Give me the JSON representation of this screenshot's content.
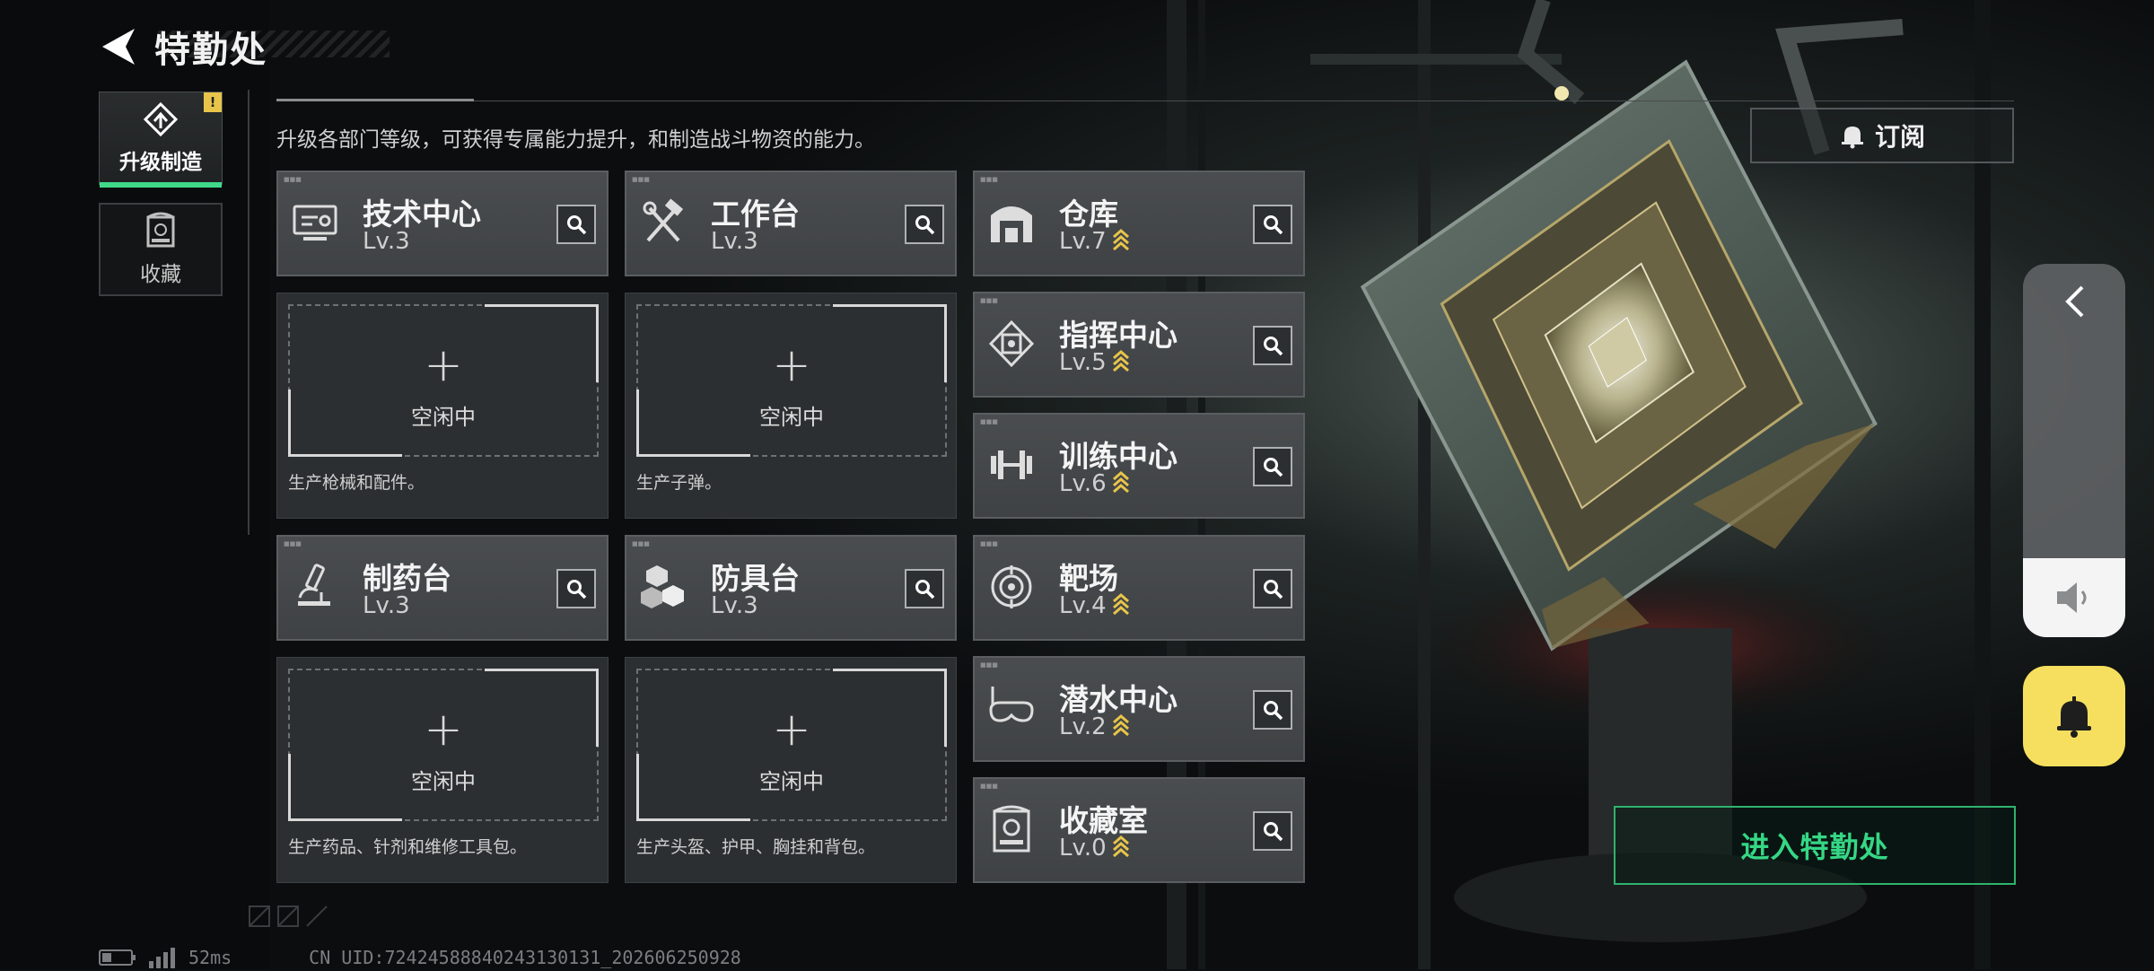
{
  "header": {
    "title": "特勤处"
  },
  "tabs": [
    {
      "label": "升级制造",
      "active": true,
      "badge": "!"
    },
    {
      "label": "收藏",
      "active": false
    }
  ],
  "description": "升级各部门等级，可获得专属能力提升，和制造战斗物资的能力。",
  "subscribe_button": {
    "label": "订阅"
  },
  "departments": {
    "tech_center": {
      "name": "技术中心",
      "level": "Lv.3",
      "icon": "monitor-icon"
    },
    "workbench": {
      "name": "工作台",
      "level": "Lv.3",
      "icon": "hammer-wrench-icon"
    },
    "pharmacy": {
      "name": "制药台",
      "level": "Lv.3",
      "icon": "microscope-icon"
    },
    "armor_bench": {
      "name": "防具台",
      "level": "Lv.3",
      "icon": "cubes-icon"
    },
    "warehouse": {
      "name": "仓库",
      "level": "Lv.7",
      "icon": "warehouse-icon",
      "upgradable": true
    },
    "command_center": {
      "name": "指挥中心",
      "level": "Lv.5",
      "icon": "chip-icon",
      "upgradable": true
    },
    "training_center": {
      "name": "训练中心",
      "level": "Lv.6",
      "icon": "dumbbell-icon",
      "upgradable": true
    },
    "shooting_range": {
      "name": "靶场",
      "level": "Lv.4",
      "icon": "target-icon",
      "upgradable": true
    },
    "diving_center": {
      "name": "潜水中心",
      "level": "Lv.2",
      "icon": "diving-mask-icon",
      "upgradable": true
    },
    "collection_room": {
      "name": "收藏室",
      "level": "Lv.0",
      "icon": "trophy-case-icon",
      "upgradable": true
    }
  },
  "slots": {
    "tech_center": {
      "status": "空闲中",
      "desc": "生产枪械和配件。"
    },
    "workbench": {
      "status": "空闲中",
      "desc": "生产子弹。"
    },
    "pharmacy": {
      "status": "空闲中",
      "desc": "生产药品、针剂和维修工具包。"
    },
    "armor_bench": {
      "status": "空闲中",
      "desc": "生产头盔、护甲、胸挂和背包。"
    }
  },
  "enter_button": {
    "label": "进入特勤处"
  },
  "footer": {
    "latency": "52ms",
    "uid": "CN UID:724245888402431301​31_202606250928"
  },
  "colors": {
    "accent_green": "#3fd98a",
    "upgrade_gold": "#e8c54a",
    "bell_yellow": "#f6df5e"
  }
}
